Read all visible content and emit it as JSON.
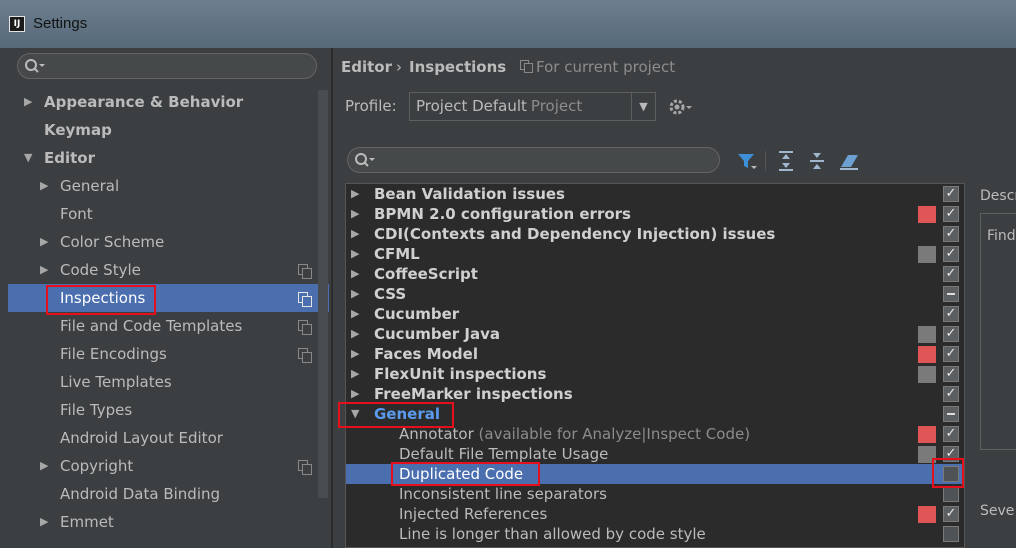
{
  "window": {
    "title": "Settings",
    "app_icon": "IJ"
  },
  "left": {
    "search_icon": "search-icon",
    "items": [
      {
        "label": "Appearance & Behavior",
        "arrow": "▶",
        "bold": true
      },
      {
        "label": "Keymap",
        "arrow": "",
        "bold": true
      },
      {
        "label": "Editor",
        "arrow": "▼",
        "bold": true
      },
      {
        "label": "General",
        "arrow": "▶"
      },
      {
        "label": "Font",
        "arrow": ""
      },
      {
        "label": "Color Scheme",
        "arrow": "▶"
      },
      {
        "label": "Code Style",
        "arrow": "▶",
        "copy": true
      },
      {
        "label": "Inspections",
        "arrow": "",
        "copy": true,
        "selected": true
      },
      {
        "label": "File and Code Templates",
        "arrow": "",
        "copy": true
      },
      {
        "label": "File Encodings",
        "arrow": "",
        "copy": true
      },
      {
        "label": "Live Templates",
        "arrow": ""
      },
      {
        "label": "File Types",
        "arrow": ""
      },
      {
        "label": "Android Layout Editor",
        "arrow": ""
      },
      {
        "label": "Copyright",
        "arrow": "▶",
        "copy": true
      },
      {
        "label": "Android Data Binding",
        "arrow": ""
      },
      {
        "label": "Emmet",
        "arrow": "▶"
      }
    ]
  },
  "breadcrumb": {
    "parent": "Editor",
    "separator": "›",
    "current": "Inspections",
    "scope": "For current project"
  },
  "profile": {
    "label": "Profile:",
    "value": "Project Default",
    "sub": "Project",
    "dropdown": "▼"
  },
  "toolbar": {
    "icons": [
      "filter-icon",
      "expand-all-icon",
      "collapse-all-icon",
      "reset-icon"
    ]
  },
  "inspections": [
    {
      "label": "Bean Validation issues",
      "type": "cat",
      "arrow": "▶",
      "sev": "",
      "check": "checked"
    },
    {
      "label": "BPMN 2.0 configuration errors",
      "type": "cat",
      "arrow": "▶",
      "sev": "#e05555",
      "check": "checked"
    },
    {
      "label": "CDI(Contexts and Dependency Injection) issues",
      "type": "cat",
      "arrow": "▶",
      "sev": "",
      "check": "checked"
    },
    {
      "label": "CFML",
      "type": "cat",
      "arrow": "▶",
      "sev": "#7a7a7a",
      "check": "checked"
    },
    {
      "label": "CoffeeScript",
      "type": "cat",
      "arrow": "▶",
      "sev": "",
      "check": "checked"
    },
    {
      "label": "CSS",
      "type": "cat",
      "arrow": "▶",
      "sev": "",
      "check": "partial"
    },
    {
      "label": "Cucumber",
      "type": "cat",
      "arrow": "▶",
      "sev": "",
      "check": "checked"
    },
    {
      "label": "Cucumber Java",
      "type": "cat",
      "arrow": "▶",
      "sev": "#7a7a7a",
      "check": "checked"
    },
    {
      "label": "Faces Model",
      "type": "cat",
      "arrow": "▶",
      "sev": "#e05555",
      "check": "checked"
    },
    {
      "label": "FlexUnit inspections",
      "type": "cat",
      "arrow": "▶",
      "sev": "#7a7a7a",
      "check": "checked"
    },
    {
      "label": "FreeMarker inspections",
      "type": "cat",
      "arrow": "▶",
      "sev": "",
      "check": "checked"
    },
    {
      "label": "General",
      "type": "cat general",
      "arrow": "▼",
      "sev": "",
      "check": "partial"
    },
    {
      "label": "Annotator",
      "hint": " (available for Analyze|Inspect Code)",
      "type": "child",
      "arrow": "",
      "sev": "#e05555",
      "check": "checked"
    },
    {
      "label": "Default File Template Usage",
      "type": "child",
      "arrow": "",
      "sev": "#7a7a7a",
      "check": "checked"
    },
    {
      "label": "Duplicated Code",
      "type": "child selected",
      "arrow": "",
      "sev": "",
      "check": "empty"
    },
    {
      "label": "Inconsistent line separators",
      "type": "child",
      "arrow": "",
      "sev": "",
      "check": "empty"
    },
    {
      "label": "Injected References",
      "type": "child",
      "arrow": "",
      "sev": "#e05555",
      "check": "checked"
    },
    {
      "label": "Line is longer than allowed by code style",
      "type": "child",
      "arrow": "",
      "sev": "",
      "check": "empty"
    }
  ],
  "description": {
    "label": "Descr",
    "text": "Find"
  },
  "severity": {
    "label": "Seve"
  }
}
